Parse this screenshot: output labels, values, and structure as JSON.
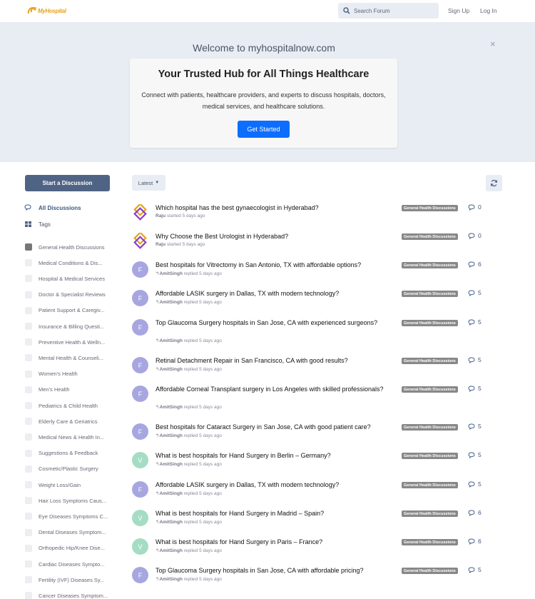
{
  "header": {
    "logo_text": "MyHospital",
    "search_placeholder": "Search Forum",
    "signup": "Sign Up",
    "login": "Log In"
  },
  "hero": {
    "welcome": "Welcome to myhospitalnow.com",
    "title": "Your Trusted Hub for All Things Healthcare",
    "description": "Connect with patients, healthcare providers, and experts to discuss hospitals, doctors, medical services, and healthcare solutions.",
    "cta": "Get Started",
    "close": "×"
  },
  "sidebar": {
    "start_button": "Start a Discussion",
    "nav": [
      {
        "label": "All Discussions",
        "icon": "comments-icon"
      },
      {
        "label": "Tags",
        "icon": "tags-grid-icon"
      }
    ],
    "tags": [
      "General Health Discussions",
      "Medical Conditions & Dis...",
      "Hospital & Medical Services",
      "Doctor & Specialist Reviews",
      "Patient Support & Caregiv...",
      "Insurance & Billing Questi...",
      "Preventive Health & Welln...",
      "Mental Health & Counseli...",
      "Women's Health",
      "Men's Health",
      "Pediatrics & Child Health",
      "Elderly Care & Geriatrics",
      "Medical News & Health In...",
      "Suggestions & Feedback",
      "Cosmetic/Plastic Surgery",
      "Weight Loss/Gain",
      "Hair Loss Symptoms Caus...",
      "Eye Diseases Symptoms C...",
      "Dental Diseases Symptom...",
      "Orthopedic Hip/Knee Dise...",
      "Cardiac Diseases Sympto...",
      "Fertility (IVF) Diseases Sy...",
      "Cancer Diseases Symptom..."
    ]
  },
  "toolbar": {
    "sort": "Latest",
    "colors": {
      "accent": "#0d6efd",
      "start_button": "#4f6485",
      "hero_bg": "#e8ecf3",
      "badge": "#888888"
    }
  },
  "discussions": [
    {
      "title": "Which hospital has the best gynaecologist in Hyderabad?",
      "user": "Raju",
      "action": "started 5 days ago",
      "avatar": "img",
      "tag": "General Health Discussions",
      "replies": "0",
      "reply_icon": false
    },
    {
      "title": "Why Choose the Best Urologist in Hyderabad?",
      "user": "Raju",
      "action": "started 5 days ago",
      "avatar": "img",
      "tag": "General Health Discussions",
      "replies": "0",
      "reply_icon": false
    },
    {
      "title": "Best hospitals for Vitrectomy in San Antonio, TX with affordable options?",
      "user": "AmitSingh",
      "action": "replied 5 days ago",
      "avatar": "F",
      "tag": "General Health Discussions",
      "replies": "6",
      "reply_icon": true
    },
    {
      "title": "Affordable LASIK surgery in Dallas, TX with modern technology?",
      "user": "AmitSingh",
      "action": "replied 5 days ago",
      "avatar": "F",
      "tag": "General Health Discussions",
      "replies": "5",
      "reply_icon": true
    },
    {
      "title": "Top Glaucoma Surgery hospitals in San Jose, CA with experienced surgeons?",
      "user": "AmitSingh",
      "action": "replied 5 days ago",
      "avatar": "F",
      "tag": "General Health Discussions",
      "replies": "5",
      "reply_icon": true
    },
    {
      "title": "Retinal Detachment Repair in San Francisco, CA with good results?",
      "user": "AmitSingh",
      "action": "replied 5 days ago",
      "avatar": "F",
      "tag": "General Health Discussions",
      "replies": "5",
      "reply_icon": true
    },
    {
      "title": "Affordable Corneal Transplant surgery in Los Angeles with skilled professionals?",
      "user": "AmitSingh",
      "action": "replied 5 days ago",
      "avatar": "F",
      "tag": "General Health Discussions",
      "replies": "5",
      "reply_icon": true
    },
    {
      "title": "Best hospitals for Cataract Surgery in San Jose, CA with good patient care?",
      "user": "AmitSingh",
      "action": "replied 5 days ago",
      "avatar": "F",
      "tag": "General Health Discussions",
      "replies": "5",
      "reply_icon": true
    },
    {
      "title": "What is best hospitals for Hand Surgery in Berlin – Germany?",
      "user": "AmitSingh",
      "action": "replied 5 days ago",
      "avatar": "V",
      "tag": "General Health Discussions",
      "replies": "5",
      "reply_icon": true
    },
    {
      "title": "Affordable LASIK surgery in Dallas, TX with modern technology?",
      "user": "AmitSingh",
      "action": "replied 5 days ago",
      "avatar": "F",
      "tag": "General Health Discussions",
      "replies": "5",
      "reply_icon": true
    },
    {
      "title": "What is best hospitals for Hand Surgery in Madrid – Spain?",
      "user": "AmitSingh",
      "action": "replied 5 days ago",
      "avatar": "V",
      "tag": "General Health Discussions",
      "replies": "6",
      "reply_icon": true
    },
    {
      "title": "What is best hospitals for Hand Surgery in Paris – France?",
      "user": "AmitSingh",
      "action": "replied 5 days ago",
      "avatar": "V",
      "tag": "General Health Discussions",
      "replies": "6",
      "reply_icon": true
    },
    {
      "title": "Top Glaucoma Surgery hospitals in San Jose, CA with affordable pricing?",
      "user": "AmitSingh",
      "action": "replied 5 days ago",
      "avatar": "F",
      "tag": "General Health Discussions",
      "replies": "5",
      "reply_icon": true
    }
  ]
}
